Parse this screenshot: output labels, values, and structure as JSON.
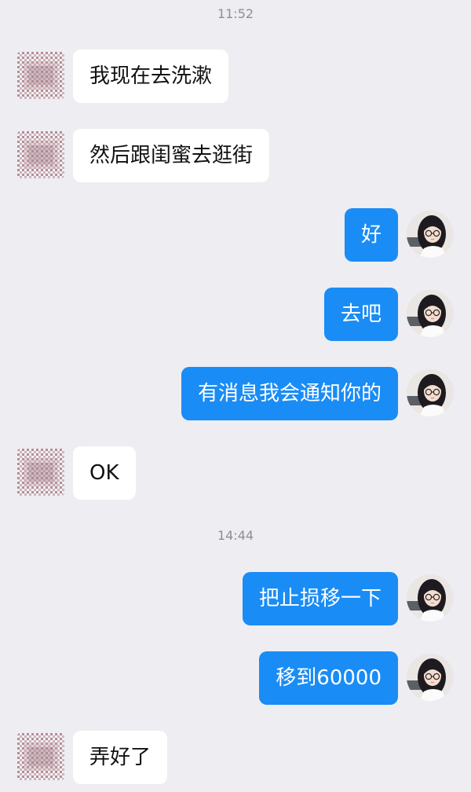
{
  "timestamps": [
    "11:52",
    "14:44"
  ],
  "messages": [
    {
      "sender": "other",
      "text": "我现在去洗漱"
    },
    {
      "sender": "other",
      "text": "然后跟闺蜜去逛街"
    },
    {
      "sender": "me",
      "text": "好"
    },
    {
      "sender": "me",
      "text": "去吧"
    },
    {
      "sender": "me",
      "text": "有消息我会通知你的"
    },
    {
      "sender": "other",
      "text": "OK"
    },
    {
      "sender": "me",
      "text": "把止损移一下"
    },
    {
      "sender": "me",
      "text": "移到60000"
    },
    {
      "sender": "other",
      "text": "弄好了"
    }
  ],
  "colors": {
    "background": "#ededf2",
    "outgoing_bubble": "#1a8cf5",
    "incoming_bubble": "#ffffff",
    "timestamp_text": "#8e8e93"
  }
}
